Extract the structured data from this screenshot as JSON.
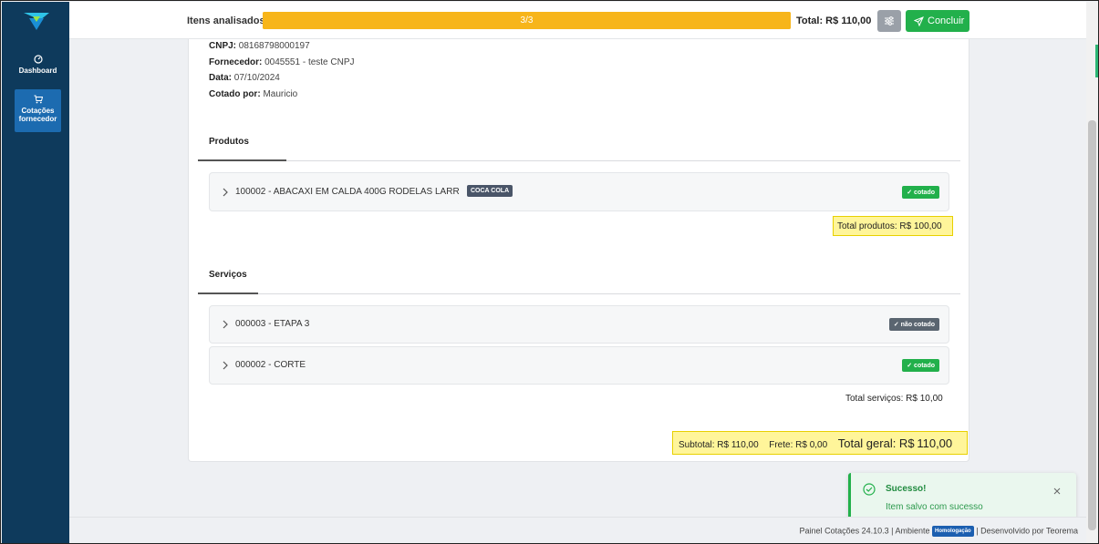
{
  "sidebar": {
    "logo_icon": "brand-logo-icon",
    "items": [
      {
        "label": "Dashboard",
        "icon": "dashboard-icon"
      },
      {
        "label_line1": "Cotações",
        "label_line2": "fornecedor",
        "icon": "cart-icon",
        "active": true
      }
    ]
  },
  "header": {
    "progress_label": "Itens analisados",
    "progress_text": "3/3",
    "progress_fraction": 1.0,
    "total_label": "Total: R$",
    "total_value": "110,00",
    "filter_icon": "sliders-icon",
    "concluir_label": "Concluir",
    "concluir_icon": "send-icon"
  },
  "info": {
    "cnpj_label": "CNPJ:",
    "cnpj_value": "08168798000197",
    "fornecedor_label": "Fornecedor:",
    "fornecedor_value": "0045551 - teste CNPJ",
    "data_label": "Data:",
    "data_value": "07/10/2024",
    "cotado_label": "Cotado por:",
    "cotado_value": "Mauricio"
  },
  "produtos": {
    "title": "Produtos",
    "items": [
      {
        "label": "100002 - ABACAXI EM CALDA 400G RODELAS LARR",
        "tag": "COCA COLA",
        "status": "cotado"
      }
    ],
    "total_label": "Total produtos: R$",
    "total_value": "100,00"
  },
  "servicos": {
    "title": "Serviços",
    "items": [
      {
        "label": "000003 - ETAPA 3",
        "status": "não cotado"
      },
      {
        "label": "000002 - CORTE",
        "status": "cotado"
      }
    ],
    "total_label": "Total serviços: R$",
    "total_value": "10,00"
  },
  "summary": {
    "subtotal_label": "Subtotal: R$",
    "subtotal_value": "110,00",
    "frete_label": "Frete: R$",
    "frete_value": "0,00",
    "geral_label": "Total geral: R$",
    "geral_value": "110,00"
  },
  "toast": {
    "title": "Sucesso!",
    "message": "Item salvo com sucesso",
    "icon": "check-circle-icon",
    "close_icon": "close-icon"
  },
  "footer": {
    "version": "Painel Cotações 24.10.3",
    "sep": "|",
    "env_label": "Ambiente",
    "env_badge": "Homologação",
    "dev": "Desenvolvido por Teorema"
  },
  "colors": {
    "sidebar": "#0e3a5c",
    "active_nav": "#1c6bb0",
    "progress": "#f7b51a",
    "success": "#22b04b",
    "highlight": "#fff59a"
  }
}
